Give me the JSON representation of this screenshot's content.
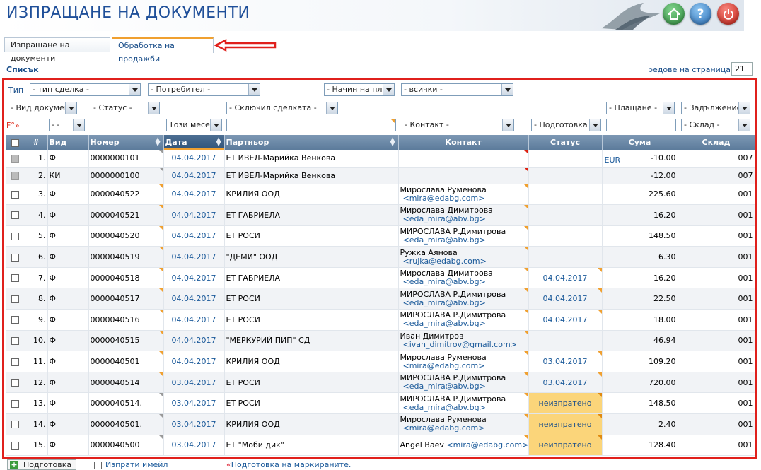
{
  "app": {
    "title": "ИЗПРАЩАНЕ НА ДОКУМЕНТИ"
  },
  "header_buttons": {
    "home": "home-icon",
    "help": "?",
    "power": "power-icon"
  },
  "tabs": [
    {
      "label": "Изпращане на документи"
    },
    {
      "label": "Обработка на продажби"
    }
  ],
  "list": {
    "title": "Списък",
    "per_page_label": "редове на страница",
    "per_page_chevron": "»",
    "per_page_value": "21"
  },
  "filters": {
    "type_label": "Тип",
    "deal_type": "- тип сделка -",
    "user": "- Потребител -",
    "payment_method": "- Начин на пла",
    "all": "- всички -",
    "doc_type": "- Вид документ",
    "status": "- Статус -",
    "concluded_by": "- Сключил сделката -",
    "payment": "- Плащане -",
    "liability": "- Задължение -",
    "f_label": "F°»",
    "dash": "- -",
    "period": "Този месец",
    "contact": "- Контакт -",
    "preparation": "- Подготовка -",
    "warehouse": "- Склад -"
  },
  "columns": {
    "num": "#",
    "type": "Вид",
    "number": "Номер",
    "date": "Дата",
    "partner": "Партньор",
    "contact": "Контакт",
    "status": "Статус",
    "sum": "Сума",
    "warehouse": "Склад"
  },
  "rows": [
    {
      "idx": "1.",
      "type": "Ф",
      "number": "0000000101",
      "date": "04.04.2017",
      "partner": "ЕТ ИВЕЛ-Марийка Венкова",
      "contact_name": "",
      "contact_mail": "",
      "status": "",
      "currency": "EUR",
      "sum": "-10.00",
      "wh": "007",
      "disabled": true
    },
    {
      "idx": "2.",
      "type": "КИ",
      "number": "0000000100",
      "date": "04.04.2017",
      "partner": "ЕТ ИВЕЛ-Марийка Венкова",
      "contact_name": "",
      "contact_mail": "",
      "status": "",
      "currency": "",
      "sum": "-12.00",
      "wh": "007",
      "disabled": true
    },
    {
      "idx": "3.",
      "type": "Ф",
      "number": "0000040522",
      "date": "04.04.2017",
      "partner": "КРИЛИЯ ООД",
      "contact_name": "Мирослава Руменова",
      "contact_mail": "<mira@edabg.com>",
      "status": "",
      "currency": "",
      "sum": "225.60",
      "wh": "001"
    },
    {
      "idx": "4.",
      "type": "Ф",
      "number": "0000040521",
      "date": "04.04.2017",
      "partner": "ЕТ ГАБРИЕЛА",
      "contact_name": "Мирослава Димитрова",
      "contact_mail": "<eda_mira@abv.bg>",
      "status": "",
      "currency": "",
      "sum": "16.20",
      "wh": "001"
    },
    {
      "idx": "5.",
      "type": "Ф",
      "number": "0000040520",
      "date": "04.04.2017",
      "partner": "ЕТ РОСИ",
      "contact_name": "МИРОСЛАВА Р.Димитрова",
      "contact_mail": "<eda_mira@abv.bg>",
      "status": "",
      "currency": "",
      "sum": "148.50",
      "wh": "001"
    },
    {
      "idx": "6.",
      "type": "Ф",
      "number": "0000040519",
      "date": "04.04.2017",
      "partner": "\"ДЕМИ\" ООД",
      "contact_name": "Ружка Аянова",
      "contact_mail": "<rujka@edabg.com>",
      "status": "",
      "currency": "",
      "sum": "6.30",
      "wh": "001"
    },
    {
      "idx": "7.",
      "type": "Ф",
      "number": "0000040518",
      "date": "04.04.2017",
      "partner": "ЕТ ГАБРИЕЛА",
      "contact_name": "Мирослава Димитрова",
      "contact_mail": "<eda_mira@abv.bg>",
      "status": "04.04.2017",
      "currency": "",
      "sum": "16.20",
      "wh": "001"
    },
    {
      "idx": "8.",
      "type": "Ф",
      "number": "0000040517",
      "date": "04.04.2017",
      "partner": "ЕТ РОСИ",
      "contact_name": "МИРОСЛАВА Р.Димитрова",
      "contact_mail": "<eda_mira@abv.bg>",
      "status": "04.04.2017",
      "currency": "",
      "sum": "22.50",
      "wh": "001"
    },
    {
      "idx": "9.",
      "type": "Ф",
      "number": "0000040516",
      "date": "04.04.2017",
      "partner": "ЕТ РОСИ",
      "contact_name": "МИРОСЛАВА Р.Димитрова",
      "contact_mail": "<eda_mira@abv.bg>",
      "status": "04.04.2017",
      "currency": "",
      "sum": "18.00",
      "wh": "001"
    },
    {
      "idx": "10.",
      "type": "Ф",
      "number": "0000040515",
      "date": "04.04.2017",
      "partner": "\"МЕРКУРИЙ ПИП\" СД",
      "contact_name": "Иван Димитров",
      "contact_mail": "<ivan_dimitrov@gmail.com>",
      "status": "",
      "currency": "",
      "sum": "46.94",
      "wh": "001"
    },
    {
      "idx": "11.",
      "type": "Ф",
      "number": "0000040501",
      "date": "04.04.2017",
      "partner": "КРИЛИЯ ООД",
      "contact_name": "Мирослава Руменова",
      "contact_mail": "<mira@edabg.com>",
      "status": "03.04.2017",
      "currency": "",
      "sum": "109.20",
      "wh": "001"
    },
    {
      "idx": "12.",
      "type": "Ф",
      "number": "0000040514",
      "date": "03.04.2017",
      "partner": "ЕТ РОСИ",
      "contact_name": "МИРОСЛАВА Р.Димитрова",
      "contact_mail": "<eda_mira@abv.bg>",
      "status": "03.04.2017",
      "currency": "",
      "sum": "720.00",
      "wh": "001"
    },
    {
      "idx": "13.",
      "type": "Ф",
      "number": "0000040514.",
      "date": "03.04.2017",
      "partner": "ЕТ РОСИ",
      "contact_name": "МИРОСЛАВА Р.Димитрова",
      "contact_mail": "<eda_mira@abv.bg>",
      "status": "неизпратено",
      "pending": true,
      "currency": "",
      "sum": "148.50",
      "wh": "001"
    },
    {
      "idx": "14.",
      "type": "Ф",
      "number": "0000040501.",
      "date": "03.04.2017",
      "partner": "КРИЛИЯ ООД",
      "contact_name": "Мирослава Руменова",
      "contact_mail": "<mira@edabg.com>",
      "status": "неизпратено",
      "pending": true,
      "currency": "",
      "sum": "2.40",
      "wh": "001"
    },
    {
      "idx": "15.",
      "type": "Ф",
      "number": "0000040500",
      "date": "03.04.2017",
      "partner": "ЕТ \"Моби дик\"",
      "contact_name": "Angel Baev",
      "contact_mail": "<mira@edabg.com>",
      "contact_inline": true,
      "status": "неизпратено",
      "pending": true,
      "currency": "",
      "sum": "128.40",
      "wh": "001"
    }
  ],
  "footer": {
    "prepare_button": "Подготовка",
    "send_email": "Изпрати имейл",
    "note_chevron": "«",
    "note": "Подготовка на маркираните."
  },
  "colors": {
    "accent": "#1b4f8a",
    "highlight": "#e0201c",
    "pending": "#fbd57a"
  }
}
